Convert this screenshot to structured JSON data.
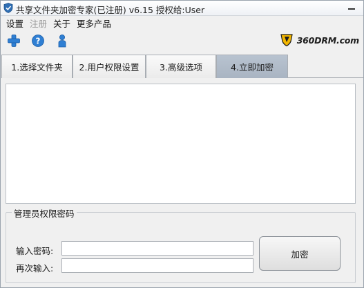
{
  "window": {
    "title": "共享文件夹加密专家(已注册) v6.15  授权给:User"
  },
  "menu": {
    "items": [
      {
        "label": "设置",
        "enabled": true
      },
      {
        "label": "注册",
        "enabled": false
      },
      {
        "label": "关于",
        "enabled": true
      },
      {
        "label": "更多产品",
        "enabled": true
      }
    ]
  },
  "toolbar": {
    "icons": [
      "add-icon",
      "help-icon",
      "user-icon"
    ]
  },
  "logo": {
    "text": "360DRM.com"
  },
  "tabs": [
    {
      "label": "1.选择文件夹",
      "active": false
    },
    {
      "label": "2.用户权限设置",
      "active": false
    },
    {
      "label": "3.高级选项",
      "active": false
    },
    {
      "label": "4.立即加密",
      "active": true
    }
  ],
  "admin_group": {
    "legend": "管理员权限密码",
    "password_label": "输入密码:",
    "password_value": "",
    "confirm_label": "再次输入:",
    "confirm_value": "",
    "encrypt_button": "加密"
  },
  "colors": {
    "active_tab": "#aeb9c7",
    "window_bg": "#f0f0f0"
  }
}
